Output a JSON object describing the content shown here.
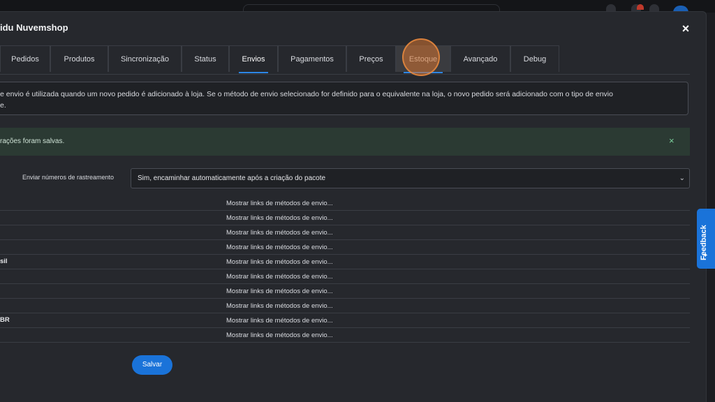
{
  "modal": {
    "title": "idu Nuvemshop",
    "close_label": "×"
  },
  "tabs": [
    {
      "label": "Pedidos"
    },
    {
      "label": "Produtos"
    },
    {
      "label": "Sincronização"
    },
    {
      "label": "Status"
    },
    {
      "label": "Envios"
    },
    {
      "label": "Pagamentos"
    },
    {
      "label": "Preços"
    },
    {
      "label": "Estoque"
    },
    {
      "label": "Avançado"
    },
    {
      "label": "Debug"
    }
  ],
  "active_tab": "Envios",
  "info": {
    "line1": "e envio é utilizada quando um novo pedido é adicionado à loja. Se o método de envio selecionado for definido para o equivalente na loja, o novo pedido será adicionado com o tipo de envio",
    "line2": "e."
  },
  "alert": {
    "text": "rações foram salvas.",
    "close_label": "×"
  },
  "tracking": {
    "label": "Enviar números de rastreamento",
    "value": "Sim, encaminhar automaticamente após a criação do pacote"
  },
  "shipping_rows": [
    {
      "label": "",
      "link": "Mostrar links de métodos de envio..."
    },
    {
      "label": "",
      "link": "Mostrar links de métodos de envio..."
    },
    {
      "label": "",
      "link": "Mostrar links de métodos de envio..."
    },
    {
      "label": "",
      "link": "Mostrar links de métodos de envio..."
    },
    {
      "label": "sil",
      "link": "Mostrar links de métodos de envio..."
    },
    {
      "label": "",
      "link": "Mostrar links de métodos de envio..."
    },
    {
      "label": "",
      "link": "Mostrar links de métodos de envio..."
    },
    {
      "label": "",
      "link": "Mostrar links de métodos de envio..."
    },
    {
      "label": "BR",
      "link": "Mostrar links de métodos de envio..."
    },
    {
      "label": "",
      "link": "Mostrar links de métodos de envio..."
    }
  ],
  "save_label": "Salvar",
  "feedback_label": "Feedback",
  "colors": {
    "primary": "#1a73d9",
    "success_bg": "#2b3a33",
    "click_highlight": "#d67432"
  }
}
